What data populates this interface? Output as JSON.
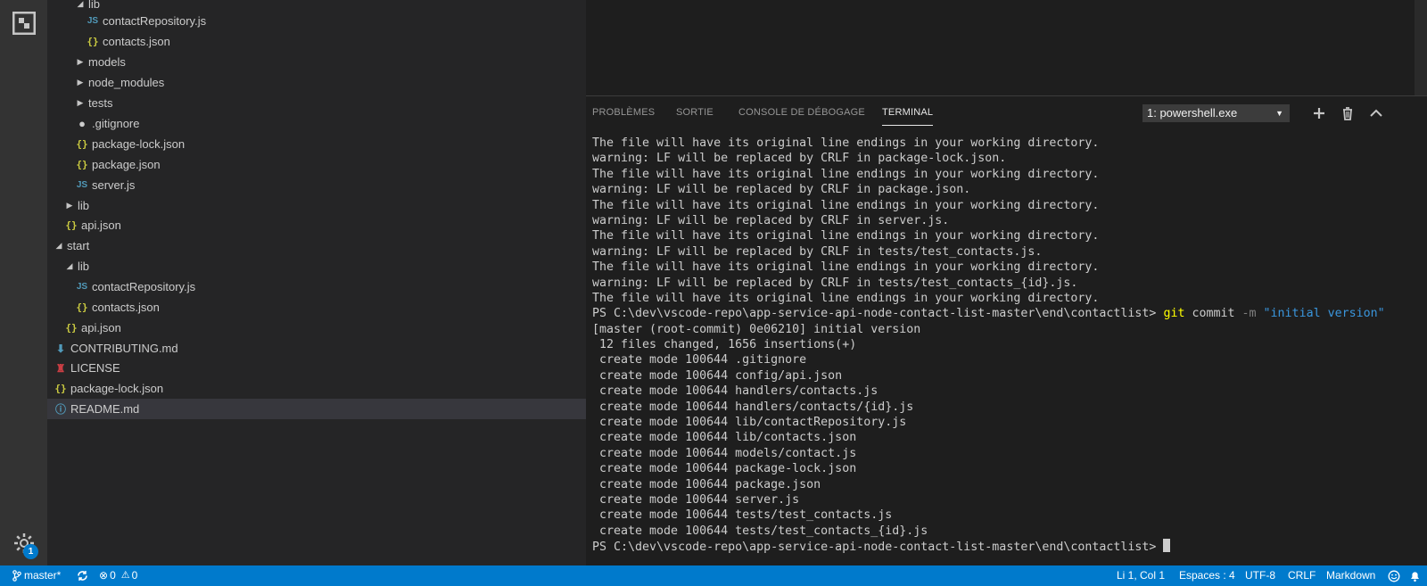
{
  "sidebar": {
    "items": [
      {
        "label": "lib",
        "type": "folder",
        "expanded": true,
        "indent": 3
      },
      {
        "label": "contactRepository.js",
        "type": "js",
        "indent": 4
      },
      {
        "label": "contacts.json",
        "type": "json",
        "indent": 4
      },
      {
        "label": "models",
        "type": "folder",
        "expanded": false,
        "indent": 3
      },
      {
        "label": "node_modules",
        "type": "folder",
        "expanded": false,
        "indent": 3
      },
      {
        "label": "tests",
        "type": "folder",
        "expanded": false,
        "indent": 3
      },
      {
        "label": ".gitignore",
        "type": "git",
        "indent": 3
      },
      {
        "label": "package-lock.json",
        "type": "json",
        "indent": 3
      },
      {
        "label": "package.json",
        "type": "json",
        "indent": 3
      },
      {
        "label": "server.js",
        "type": "js",
        "indent": 3
      },
      {
        "label": "lib",
        "type": "folder",
        "expanded": false,
        "indent": 2
      },
      {
        "label": "api.json",
        "type": "json",
        "indent": 2
      },
      {
        "label": "start",
        "type": "folder",
        "expanded": true,
        "indent": 1
      },
      {
        "label": "lib",
        "type": "folder",
        "expanded": true,
        "indent": 2
      },
      {
        "label": "contactRepository.js",
        "type": "js",
        "indent": 3
      },
      {
        "label": "contacts.json",
        "type": "json",
        "indent": 3
      },
      {
        "label": "api.json",
        "type": "json",
        "indent": 2
      },
      {
        "label": "CONTRIBUTING.md",
        "type": "md",
        "indent": 1
      },
      {
        "label": "LICENSE",
        "type": "license",
        "indent": 1
      },
      {
        "label": "package-lock.json",
        "type": "json",
        "indent": 1
      },
      {
        "label": "README.md",
        "type": "info",
        "indent": 1,
        "selected": true
      }
    ]
  },
  "activity": {
    "logo_icon": "explorer-logo-icon",
    "gear_icon": "gear-icon",
    "badge_count": "1"
  },
  "panel": {
    "tabs": [
      {
        "label": "PROBLÈMES",
        "active": false
      },
      {
        "label": "SORTIE",
        "active": false
      },
      {
        "label": "CONSOLE DE DÉBOGAGE",
        "active": false
      },
      {
        "label": "TERMINAL",
        "active": true
      }
    ],
    "terminal_select": "1: powershell.exe",
    "icons": [
      "plus-icon",
      "trash-icon",
      "chevron-up-icon"
    ]
  },
  "terminal": {
    "lines": [
      "The file will have its original line endings in your working directory.",
      "warning: LF will be replaced by CRLF in package-lock.json.",
      "The file will have its original line endings in your working directory.",
      "warning: LF will be replaced by CRLF in package.json.",
      "The file will have its original line endings in your working directory.",
      "warning: LF will be replaced by CRLF in server.js.",
      "The file will have its original line endings in your working directory.",
      "warning: LF will be replaced by CRLF in tests/test_contacts.js.",
      "The file will have its original line endings in your working directory.",
      "warning: LF will be replaced by CRLF in tests/test_contacts_{id}.js.",
      "The file will have its original line endings in your working directory."
    ],
    "command_prompt": "PS C:\\dev\\vscode-repo\\app-service-api-node-contact-list-master\\end\\contactlist> ",
    "command_git": "git",
    "command_sub": " commit ",
    "command_flag": "-m",
    "command_msg": " \"initial version\"",
    "output": [
      "[master (root-commit) 0e06210] initial version",
      " 12 files changed, 1656 insertions(+)",
      " create mode 100644 .gitignore",
      " create mode 100644 config/api.json",
      " create mode 100644 handlers/contacts.js",
      " create mode 100644 handlers/contacts/{id}.js",
      " create mode 100644 lib/contactRepository.js",
      " create mode 100644 lib/contacts.json",
      " create mode 100644 models/contact.js",
      " create mode 100644 package-lock.json",
      " create mode 100644 package.json",
      " create mode 100644 server.js",
      " create mode 100644 tests/test_contacts.js",
      " create mode 100644 tests/test_contacts_{id}.js"
    ],
    "final_prompt": "PS C:\\dev\\vscode-repo\\app-service-api-node-contact-list-master\\end\\contactlist> "
  },
  "statusbar": {
    "branch": "master*",
    "errors": "0",
    "warnings": "0",
    "position": "Li 1, Col 1",
    "spaces": "Espaces : 4",
    "encoding": "UTF-8",
    "eol": "CRLF",
    "language": "Markdown"
  },
  "colors": {
    "accent": "#007acc",
    "sidebar_bg": "#252526",
    "editor_bg": "#1e1e1e"
  }
}
